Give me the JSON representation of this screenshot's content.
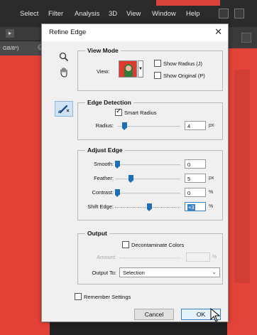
{
  "app": {
    "menu": [
      "Select",
      "Filter",
      "Analysis",
      "3D",
      "View",
      "Window",
      "Help"
    ],
    "doc_tab": "GB/8*)",
    "doc_tab_close": "×",
    "opt_icon": "▸"
  },
  "dialog": {
    "title": "Refine Edge",
    "close": "✕",
    "tools": [
      "zoom-icon",
      "hand-icon",
      "refine-radius-brush-icon"
    ],
    "view_mode": {
      "title": "View Mode",
      "view_label": "View:",
      "view_drop": "▼",
      "show_radius": "Show Radius (J)",
      "show_radius_checked": false,
      "show_original": "Show Original (P)",
      "show_original_checked": false
    },
    "edge_detection": {
      "title": "Edge Detection",
      "smart_radius": "Smart Radius",
      "smart_radius_checked": true,
      "radius_label": "Radius:",
      "radius_value": "4",
      "radius_unit": "px",
      "radius_slider": 0.07
    },
    "adjust_edge": {
      "title": "Adjust Edge",
      "smooth_label": "Smooth:",
      "smooth_value": "0",
      "smooth_slider": 0.0,
      "feather_label": "Feather:",
      "feather_value": "5",
      "feather_unit": "px",
      "feather_slider": 0.22,
      "contrast_label": "Contrast:",
      "contrast_value": "0",
      "contrast_unit": "%",
      "contrast_slider": 0.0,
      "shift_label": "Shift Edge:",
      "shift_value": "+3",
      "shift_unit": "%",
      "shift_slider": 0.53
    },
    "output": {
      "title": "Output",
      "decontaminate": "Decontaminate Colors",
      "decontaminate_checked": false,
      "amount_label": "Amount:",
      "amount_unit": "%",
      "output_to_label": "Output To:",
      "output_to_value": "Selection",
      "output_to_chevron": "⌄"
    },
    "remember": "Remember Settings",
    "remember_checked": false,
    "cancel": "Cancel",
    "ok": "OK"
  }
}
